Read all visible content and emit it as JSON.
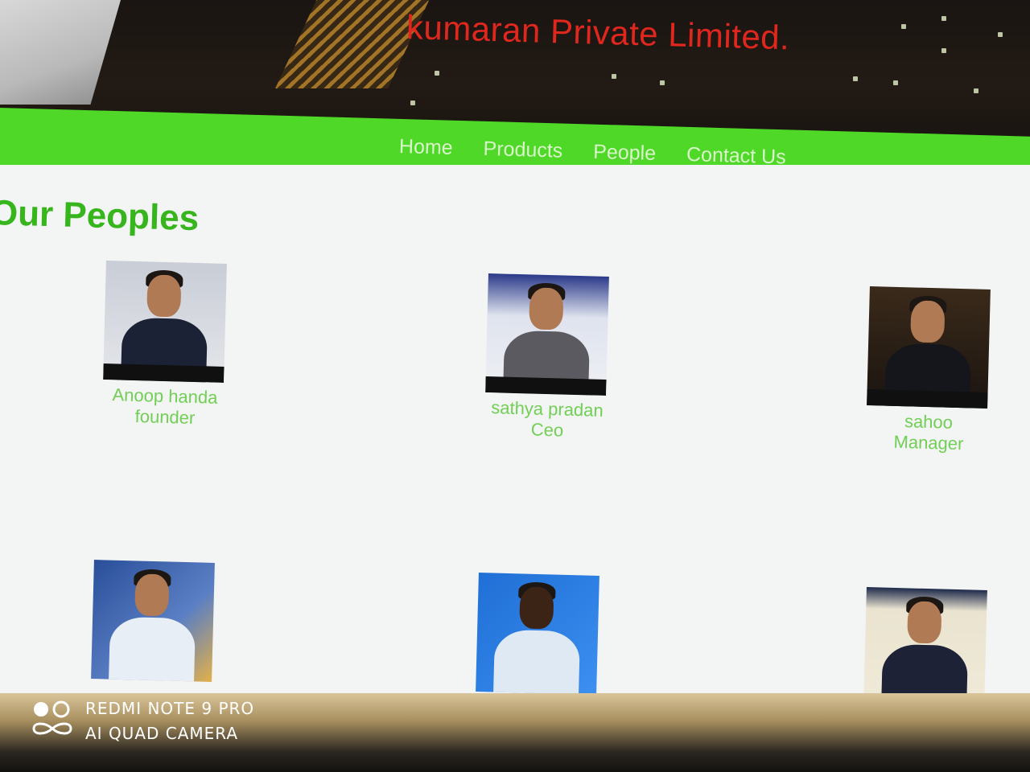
{
  "header": {
    "brand_title": "kumaran Private Limited."
  },
  "nav": {
    "items": [
      "Home",
      "Products",
      "People",
      "Contact Us"
    ]
  },
  "main": {
    "title": "Our Peoples",
    "people": [
      {
        "name": "Anoop handa",
        "role": "founder"
      },
      {
        "name": "sathya pradan",
        "role": "Ceo"
      },
      {
        "name": "sahoo",
        "role": "Manager"
      },
      {
        "name": "",
        "role": ""
      },
      {
        "name": "",
        "role": ""
      },
      {
        "name": "",
        "role": ""
      }
    ]
  },
  "watermark": {
    "line1": "REDMI NOTE 9 PRO",
    "line2": "AI QUAD CAMERA"
  },
  "colors": {
    "nav_green": "#4fd827",
    "title_green": "#36b51c",
    "name_green": "#72cf55",
    "brand_red": "#e0271d"
  }
}
